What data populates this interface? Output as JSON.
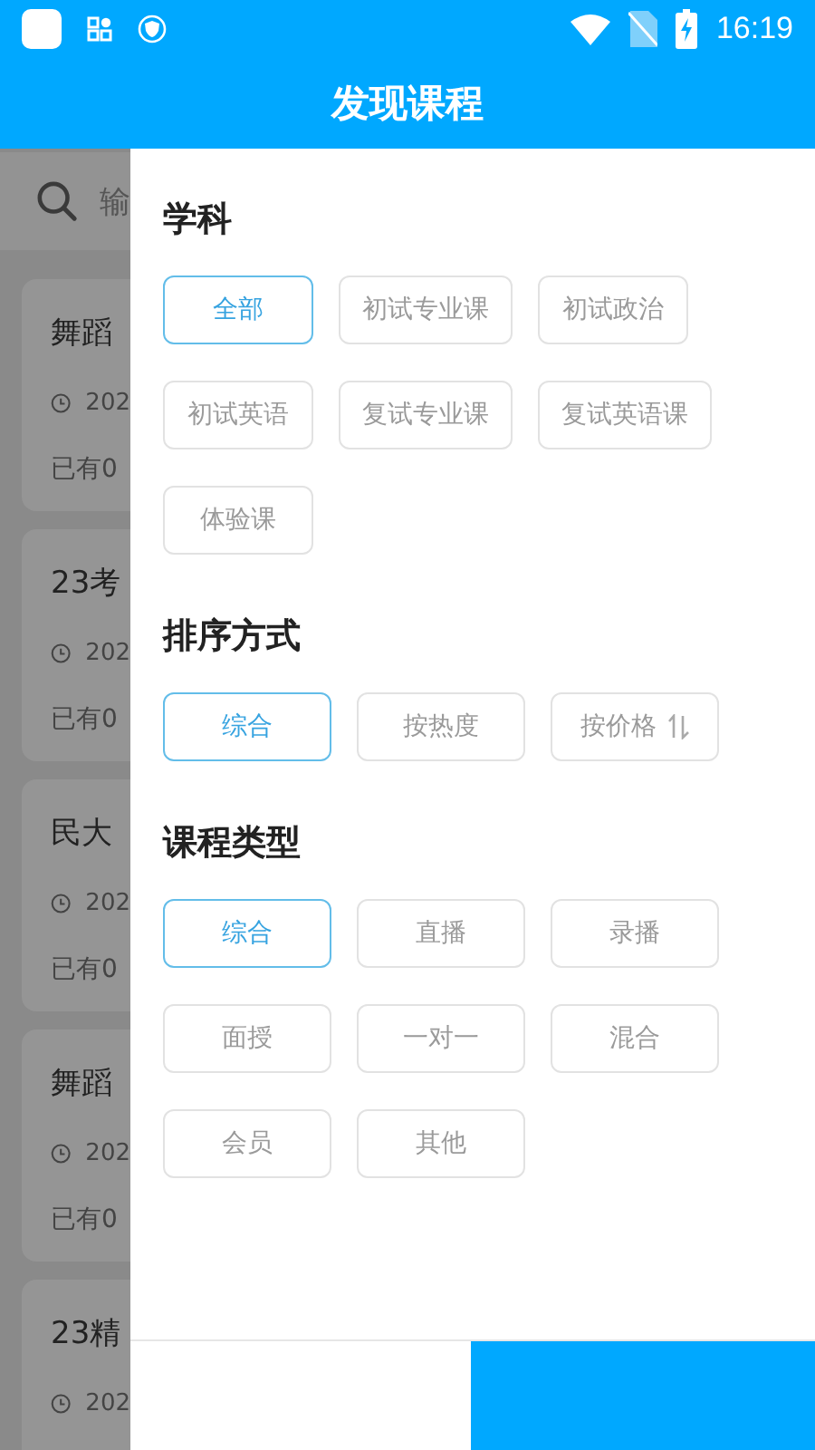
{
  "status_bar": {
    "time": "16:19"
  },
  "header": {
    "title": "发现课程"
  },
  "background_list": {
    "search": {
      "placeholder": "输"
    },
    "cards": [
      {
        "title": "舞蹈",
        "date": "202",
        "enrolled": "已有0"
      },
      {
        "title": "23考",
        "date": "202",
        "enrolled": "已有0"
      },
      {
        "title": "民大",
        "date": "202",
        "enrolled": "已有0"
      },
      {
        "title": "舞蹈",
        "date": "202",
        "enrolled": "已有0"
      },
      {
        "title": "23精",
        "date": "202"
      }
    ]
  },
  "filter": {
    "sections": [
      {
        "title": "学科",
        "kind": "compact",
        "options": [
          {
            "label": "全部",
            "selected": true
          },
          {
            "label": "初试专业课",
            "selected": false
          },
          {
            "label": "初试政治",
            "selected": false
          },
          {
            "label": "初试英语",
            "selected": false
          },
          {
            "label": "复试专业课",
            "selected": false
          },
          {
            "label": "复试英语课",
            "selected": false
          },
          {
            "label": "体验课",
            "selected": false
          }
        ]
      },
      {
        "title": "排序方式",
        "kind": "wide",
        "options": [
          {
            "label": "综合",
            "selected": true
          },
          {
            "label": "按热度",
            "selected": false
          },
          {
            "label": "按价格",
            "selected": false,
            "sort_icon": true
          }
        ]
      },
      {
        "title": "课程类型",
        "kind": "wide",
        "options": [
          {
            "label": "综合",
            "selected": true
          },
          {
            "label": "直播",
            "selected": false
          },
          {
            "label": "录播",
            "selected": false
          },
          {
            "label": "面授",
            "selected": false
          },
          {
            "label": "一对一",
            "selected": false
          },
          {
            "label": "混合",
            "selected": false
          },
          {
            "label": "会员",
            "selected": false
          },
          {
            "label": "其他",
            "selected": false
          }
        ]
      }
    ]
  }
}
